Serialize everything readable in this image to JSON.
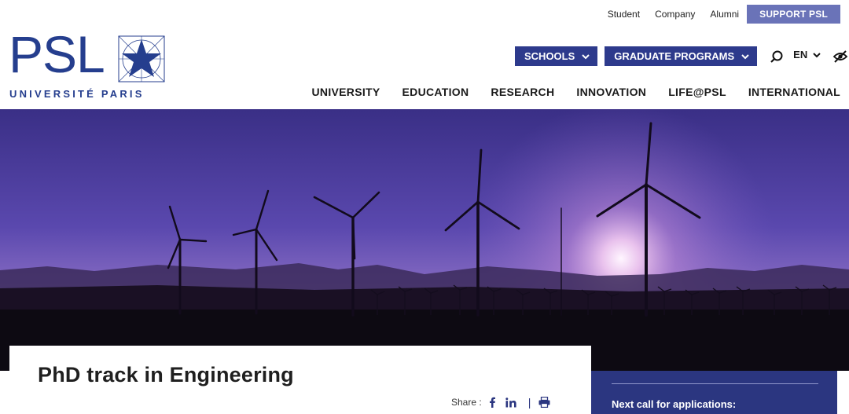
{
  "utility": {
    "links": [
      "Student",
      "Company",
      "Alumni"
    ],
    "support_label": "SUPPORT PSL"
  },
  "logo": {
    "title": "PSL",
    "subtitle": "UNIVERSITÉ PARIS",
    "icon": "star-icon"
  },
  "header": {
    "schools_label": "SCHOOLS",
    "graduate_label": "GRADUATE PROGRAMS",
    "language": "EN",
    "icons": [
      "chevron-down-icon",
      "search-icon",
      "eye-off-icon"
    ]
  },
  "nav": {
    "items": [
      "UNIVERSITY",
      "EDUCATION",
      "RESEARCH",
      "INNOVATION",
      "LIFE@PSL",
      "INTERNATIONAL"
    ]
  },
  "page": {
    "title": "PhD track in Engineering",
    "share_label": "Share :",
    "share_icons": [
      "facebook-icon",
      "linkedin-icon",
      "print-icon"
    ]
  },
  "sidebar": {
    "next_call_label": "Next call for applications:"
  },
  "colors": {
    "brand": "#253e8e",
    "button": "#2d3a8c",
    "support": "#6a73b8",
    "panel": "#2b3680"
  }
}
